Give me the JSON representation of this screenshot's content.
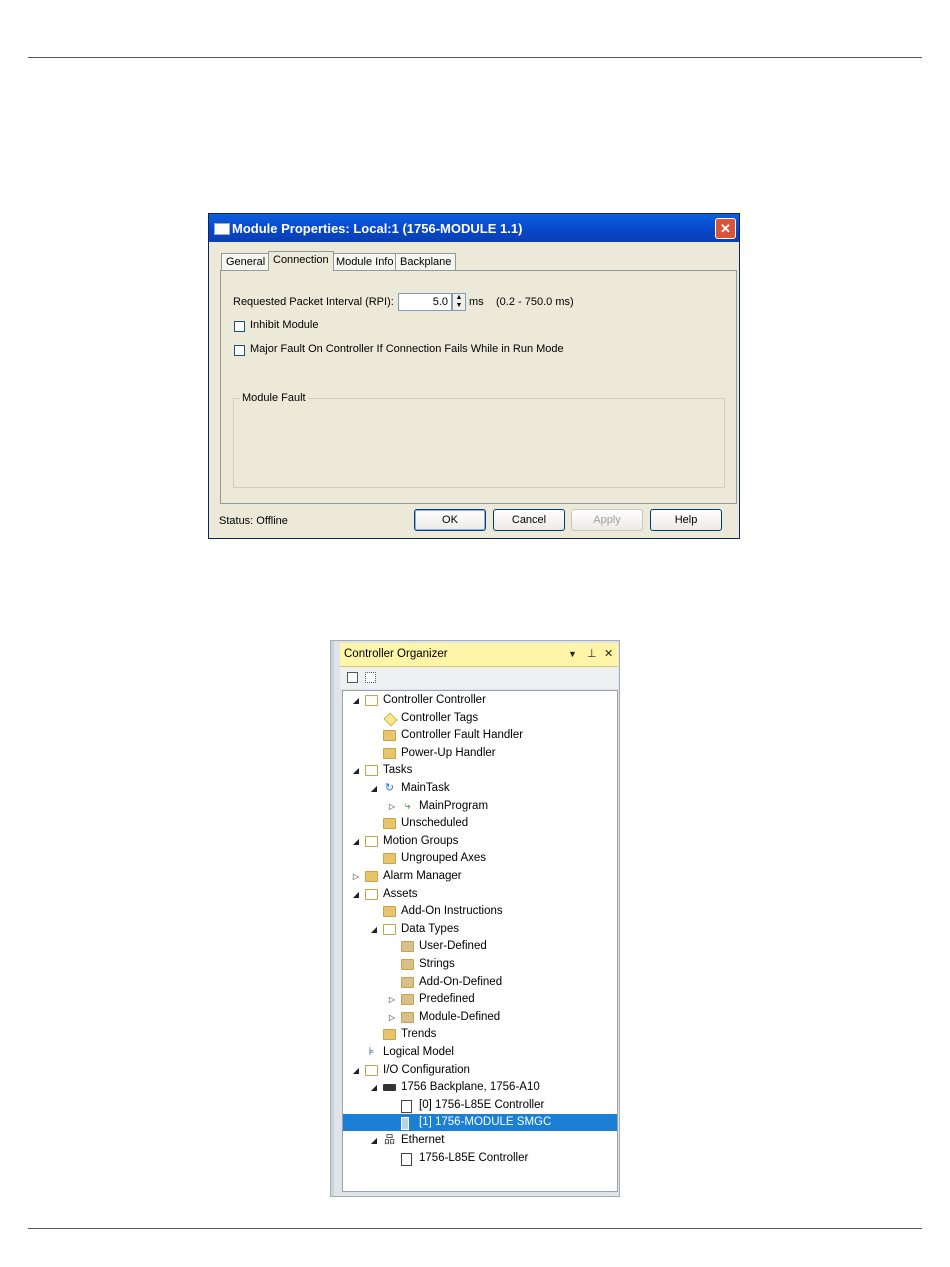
{
  "dialog": {
    "title": "Module Properties: Local:1 (1756-MODULE 1.1)",
    "close_glyph": "✕",
    "tabs": [
      "General",
      "Connection",
      "Module Info",
      "Backplane"
    ],
    "rpi_label": "Requested Packet Interval (RPI):",
    "rpi_value": "5.0",
    "rpi_unit": "ms",
    "rpi_range": "(0.2 - 750.0 ms)",
    "inhibit_label": "Inhibit Module",
    "major_fault_label": "Major Fault On Controller If Connection Fails While in Run Mode",
    "module_fault_label": "Module Fault",
    "status": "Status:  Offline",
    "buttons": {
      "ok": "OK",
      "cancel": "Cancel",
      "apply": "Apply",
      "help": "Help"
    }
  },
  "organizer": {
    "title": "Controller Organizer",
    "header_icons": {
      "dropdown": "▼",
      "pin": "⊥",
      "close": "✕"
    },
    "tree": [
      {
        "label": "Controller Controller",
        "level": 0,
        "expander": "◢",
        "icon": "folder-open-icon"
      },
      {
        "label": "Controller Tags",
        "level": 1,
        "expander": "",
        "icon": "tag-icon"
      },
      {
        "label": "Controller Fault Handler",
        "level": 1,
        "expander": "",
        "icon": "folder-closed-icon"
      },
      {
        "label": "Power-Up Handler",
        "level": 1,
        "expander": "",
        "icon": "folder-closed-icon"
      },
      {
        "label": "Tasks",
        "level": 0,
        "expander": "◢",
        "icon": "folder-open-icon"
      },
      {
        "label": "MainTask",
        "level": 1,
        "expander": "◢",
        "icon": "task-icon"
      },
      {
        "label": "MainProgram",
        "level": 2,
        "expander": "▷",
        "icon": "program-icon"
      },
      {
        "label": "Unscheduled",
        "level": 1,
        "expander": "",
        "icon": "folder-closed-icon"
      },
      {
        "label": "Motion Groups",
        "level": 0,
        "expander": "◢",
        "icon": "folder-open-icon"
      },
      {
        "label": "Ungrouped Axes",
        "level": 1,
        "expander": "",
        "icon": "folder-closed-icon"
      },
      {
        "label": "Alarm Manager",
        "level": 0,
        "expander": "▷",
        "icon": "folder-closed-icon"
      },
      {
        "label": "Assets",
        "level": 0,
        "expander": "◢",
        "icon": "folder-open-icon"
      },
      {
        "label": "Add-On Instructions",
        "level": 1,
        "expander": "",
        "icon": "folder-closed-icon"
      },
      {
        "label": "Data Types",
        "level": 1,
        "expander": "◢",
        "icon": "folder-open-icon"
      },
      {
        "label": "User-Defined",
        "level": 2,
        "expander": "",
        "icon": "datatype-icon"
      },
      {
        "label": "Strings",
        "level": 2,
        "expander": "",
        "icon": "datatype-icon"
      },
      {
        "label": "Add-On-Defined",
        "level": 2,
        "expander": "",
        "icon": "datatype-icon"
      },
      {
        "label": "Predefined",
        "level": 2,
        "expander": "▷",
        "icon": "datatype-icon"
      },
      {
        "label": "Module-Defined",
        "level": 2,
        "expander": "▷",
        "icon": "datatype-icon"
      },
      {
        "label": "Trends",
        "level": 1,
        "expander": "",
        "icon": "folder-closed-icon"
      },
      {
        "label": "Logical Model",
        "level": 0,
        "expander": "",
        "icon": "logical-model-icon"
      },
      {
        "label": "I/O Configuration",
        "level": 0,
        "expander": "◢",
        "icon": "folder-open-icon"
      },
      {
        "label": "1756 Backplane, 1756-A10",
        "level": 1,
        "expander": "◢",
        "icon": "backplane-icon"
      },
      {
        "label": "[0] 1756-L85E Controller",
        "level": 2,
        "expander": "",
        "icon": "controller-icon"
      },
      {
        "label": "[1] 1756-MODULE SMGC",
        "level": 2,
        "expander": "",
        "icon": "module-icon",
        "selected": true
      },
      {
        "label": "Ethernet",
        "level": 1,
        "expander": "◢",
        "icon": "network-icon"
      },
      {
        "label": "1756-L85E Controller",
        "level": 2,
        "expander": "",
        "icon": "controller-icon"
      }
    ]
  },
  "colors": {
    "selection": "#1c7fd6",
    "organizer_header": "#fff5a8",
    "dialog_titlebar": "#0a5fe0"
  }
}
